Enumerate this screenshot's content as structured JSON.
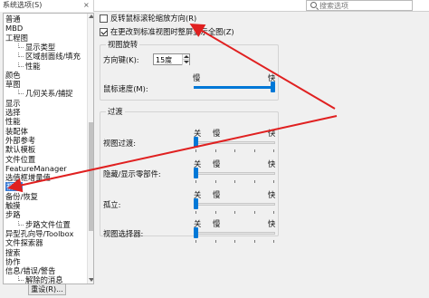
{
  "window": {
    "tab_title": "系统选项(S)",
    "tab_close": "×",
    "search_placeholder": "搜索选项"
  },
  "tree": {
    "items": [
      {
        "label": "普通",
        "indent": 0
      },
      {
        "label": "MBD",
        "indent": 0
      },
      {
        "label": "工程图",
        "indent": 0
      },
      {
        "label": "显示类型",
        "indent": 1
      },
      {
        "label": "区域剖面线/填充",
        "indent": 1
      },
      {
        "label": "性能",
        "indent": 1
      },
      {
        "label": "颜色",
        "indent": 0
      },
      {
        "label": "草图",
        "indent": 0
      },
      {
        "label": "几何关系/捕捉",
        "indent": 1
      },
      {
        "label": "显示",
        "indent": 0
      },
      {
        "label": "选择",
        "indent": 0
      },
      {
        "label": "性能",
        "indent": 0
      },
      {
        "label": "装配体",
        "indent": 0
      },
      {
        "label": "外部参考",
        "indent": 0
      },
      {
        "label": "默认模板",
        "indent": 0
      },
      {
        "label": "文件位置",
        "indent": 0
      },
      {
        "label": "FeatureManager",
        "indent": 0
      },
      {
        "label": "选值框增量值",
        "indent": 0
      },
      {
        "label": "视图",
        "indent": 0,
        "selected": true
      },
      {
        "label": "备份/恢复",
        "indent": 0
      },
      {
        "label": "触摸",
        "indent": 0
      },
      {
        "label": "步路",
        "indent": 0
      },
      {
        "label": "步路文件位置",
        "indent": 1
      },
      {
        "label": "异型孔向导/Toolbox",
        "indent": 0
      },
      {
        "label": "文件探索器",
        "indent": 0
      },
      {
        "label": "搜索",
        "indent": 0
      },
      {
        "label": "协作",
        "indent": 0
      },
      {
        "label": "信息/错误/警告",
        "indent": 0
      },
      {
        "label": "解除的消息",
        "indent": 1
      }
    ],
    "reset_label": "重设(R)..."
  },
  "options": {
    "reverse_wheel_zoom": {
      "label": "反转鼠标滚轮缩放方向(R)",
      "checked": false
    },
    "zoom_to_fit": {
      "label": "在更改到标准视图时整屏显示全图(Z)",
      "checked": true
    },
    "view_rotation": {
      "title": "视图旋转",
      "arrow_keys_label": "方向键(K):",
      "arrow_keys_value": "15度",
      "mouse_speed_label": "鼠标速度(M):",
      "mouse_speed_slow": "慢",
      "mouse_speed_fast": "快",
      "mouse_speed_value": 1.0
    },
    "transitions": {
      "title": "过渡",
      "rows": [
        {
          "label": "视图过渡:",
          "off": "关",
          "slow": "慢",
          "fast": "快",
          "value": 0.0
        },
        {
          "label": "隐藏/显示零部件:",
          "off": "关",
          "slow": "慢",
          "fast": "快",
          "value": 0.0
        },
        {
          "label": "孤立:",
          "off": "关",
          "slow": "慢",
          "fast": "快",
          "value": 0.0
        },
        {
          "label": "视图选择器:",
          "off": "关",
          "slow": "慢",
          "fast": "快",
          "value": 0.0
        }
      ]
    }
  },
  "colors": {
    "accent": "#0078d7",
    "selection": "#3b7bd4",
    "annotation": "#e02020"
  }
}
